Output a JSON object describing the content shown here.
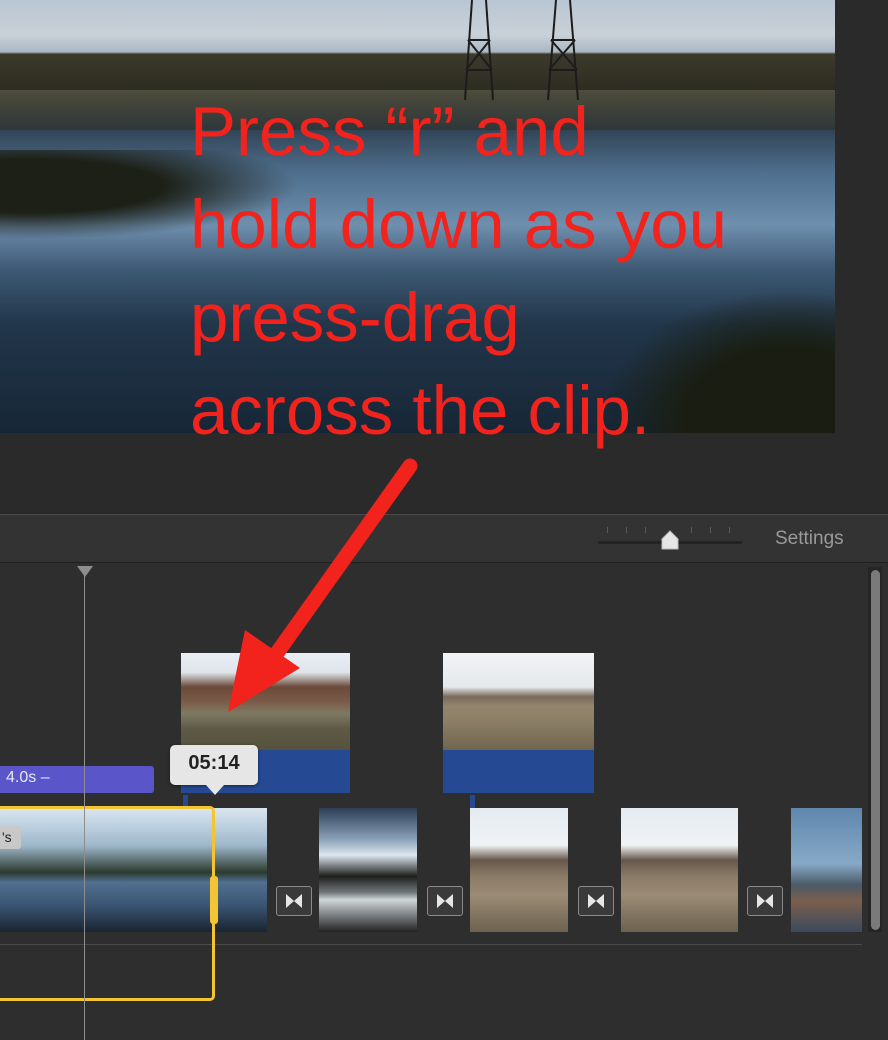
{
  "toolbar": {
    "settings_label": "Settings"
  },
  "timeline": {
    "title_clip_label": "4.0s –",
    "clip_tag": "'s",
    "tooltip_time": "05:14"
  },
  "annotation": {
    "lines": [
      "Press “r” and",
      "hold down as you",
      "press-drag",
      "across the clip."
    ],
    "color": "#f2231c"
  },
  "colors": {
    "selection": "#f3c433",
    "title_bar": "#5a55c8",
    "audio_bar": "#254a93"
  },
  "icons": [
    "transition-icon",
    "zoom-slider-knob-icon",
    "playhead-icon",
    "arrow-icon"
  ]
}
